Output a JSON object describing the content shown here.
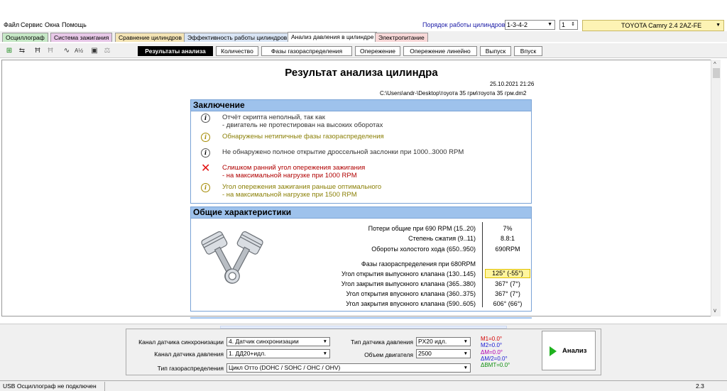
{
  "menu": [
    "Файл",
    "Сервис",
    "Окна",
    "Помощь"
  ],
  "header": {
    "order_label": "Порядок работы цилиндров",
    "order_value": "1-3-4-2",
    "cyl_value": "1",
    "car": "TOYOTA Camry 2.4 2AZ-FE"
  },
  "tabs": [
    {
      "label": "Осциллограф",
      "color": "#c6e8c6"
    },
    {
      "label": "Система зажигания",
      "color": "#e8c8e8"
    },
    {
      "label": "Сравнение цилиндров",
      "color": "#f4e4b4"
    },
    {
      "label": "Эффективность работы цилиндров",
      "color": "#d8e4f4"
    },
    {
      "label": "Анализ давления в цилиндре",
      "color": "#ffffff"
    },
    {
      "label": "Электропитание",
      "color": "#f8d8d8"
    }
  ],
  "subtabs": [
    "Результаты анализа",
    "Количество",
    "Фазы газораспределения",
    "Опережение",
    "Опережение линейно",
    "Выпуск",
    "Впуск"
  ],
  "report": {
    "title": "Результат анализа цилиндра",
    "date": "25.10.2021 21:26",
    "path": "C:\\Users\\andr-\\Desktop\\тоуота 35 грм\\тоуота 35 грм.dm2"
  },
  "conclusion": {
    "heading": "Заключение",
    "items": [
      {
        "icon": "info-icon",
        "line1": "Отчёт скрипта неполный, так как",
        "line2": "- двигатель не протестирован на высоких оборотах",
        "color": "gray"
      },
      {
        "icon": "info-icon",
        "line1": "Обнаружены нетипичные фазы газораспределения",
        "line2": "",
        "color": "olive"
      },
      {
        "icon": "info-icon",
        "line1": "Не обнаружено полное открытие дроссельной заслонки при 1000..3000 RPM",
        "line2": "",
        "color": "gray"
      },
      {
        "icon": "cross-icon",
        "line1": "Слишком ранний угол опережения зажигания",
        "line2": "- на максимальной нагрузке при 1000 RPM",
        "color": "red"
      },
      {
        "icon": "info-icon",
        "line1": "Угол опережения зажигания раньше оптимального",
        "line2": "- на максимальной нагрузке при 1500 RPM",
        "color": "olive"
      }
    ]
  },
  "general": {
    "heading": "Общие характеристики",
    "rows": [
      {
        "label": "Потери общие при 690 RPM (15..20)",
        "value": "7%",
        "highlight": false
      },
      {
        "label": "Степень сжатия (9..11)",
        "value": "8.8:1",
        "highlight": false
      },
      {
        "label": "Обороты холостого хода (650..950)",
        "value": "690RPM",
        "highlight": false
      },
      {
        "label": "Фазы газораспределения при 680RPM",
        "value": "",
        "highlight": false
      },
      {
        "label": "Угол открытия выпускного клапана (130..145)",
        "value": "125° (-55°)",
        "highlight": true
      },
      {
        "label": "Угол закрытия выпускного клапана (365..380)",
        "value": "367°  (7°)",
        "highlight": false
      },
      {
        "label": "Угол открытия впускного клапана (360..375)",
        "value": "367°  (7°)",
        "highlight": false
      },
      {
        "label": "Угол закрытия впускного клапана (590..605)",
        "value": "606° (66°)",
        "highlight": false
      }
    ]
  },
  "settings": {
    "sync_label": "Канал датчика синхронизации",
    "sync_value": "4.  Датчик синхронизации",
    "press_label": "Канал датчика давления",
    "press_value": "1.  ДД20+идл.",
    "gas_label": "Тип газораспределения",
    "gas_value": "Цикл Отто (DOHC / SOHC / OHC / OHV)",
    "sensor_label": "Тип датчика давления",
    "sensor_value": "PX20 идл.",
    "volume_label": "Объем двигателя",
    "volume_value": "2500"
  },
  "markers": [
    {
      "text": "M1=0.0°",
      "color": "#d40000"
    },
    {
      "text": "M2=0.0°",
      "color": "#1a1ad4"
    },
    {
      "text": "ΔM=0.0°",
      "color": "#b000b0"
    },
    {
      "text": "ΔM/2=0.0°",
      "color": "#1a1ad4"
    },
    {
      "text": "ΔВМТ=0.0°",
      "color": "#109010"
    }
  ],
  "analyze_label": "Анализ",
  "status": {
    "text": "USB Осциллограф не подключен",
    "version": "2.3"
  }
}
